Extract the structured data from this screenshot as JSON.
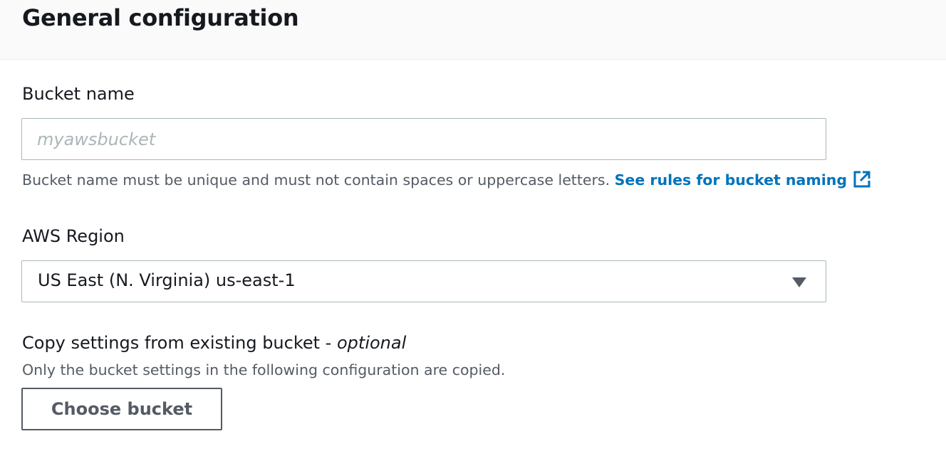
{
  "section": {
    "title": "General configuration"
  },
  "bucket_name": {
    "label": "Bucket name",
    "value": "",
    "placeholder": "myawsbucket",
    "description": "Bucket name must be unique and must not contain spaces or uppercase letters.",
    "rules_link": "See rules for bucket naming",
    "rules_link_icon": "external-link-icon"
  },
  "region": {
    "label": "AWS Region",
    "selected": "US East (N. Virginia) us-east-1",
    "caret_icon": "caret-down-icon"
  },
  "copy_settings": {
    "label": "Copy settings from existing bucket - ",
    "label_suffix": "optional",
    "description": "Only the bucket settings in the following configuration are copied.",
    "button_label": "Choose bucket"
  },
  "colors": {
    "link": "#0073bb",
    "border": "#aab7b8",
    "header_bg": "#fafafa",
    "muted_text": "#545b64"
  }
}
